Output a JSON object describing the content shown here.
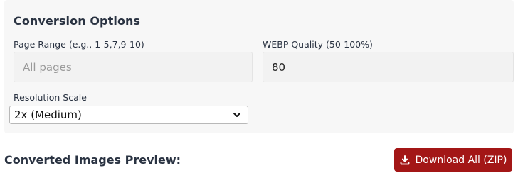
{
  "options": {
    "title": "Conversion Options",
    "page_range": {
      "label": "Page Range (e.g., 1-5,7,9-10)",
      "placeholder": "All pages",
      "value": ""
    },
    "webp_quality": {
      "label": "WEBP Quality (50-100%)",
      "value": "80"
    },
    "resolution": {
      "label": "Resolution Scale",
      "selected": "2x (Medium)"
    }
  },
  "preview": {
    "title": "Converted Images Preview:"
  },
  "download": {
    "label": "Download All (ZIP)"
  },
  "colors": {
    "button_bg": "#a31616",
    "panel_bg": "#f7f7f7"
  },
  "icons": {
    "download": "download-icon",
    "select": "chevron-down-icon"
  }
}
